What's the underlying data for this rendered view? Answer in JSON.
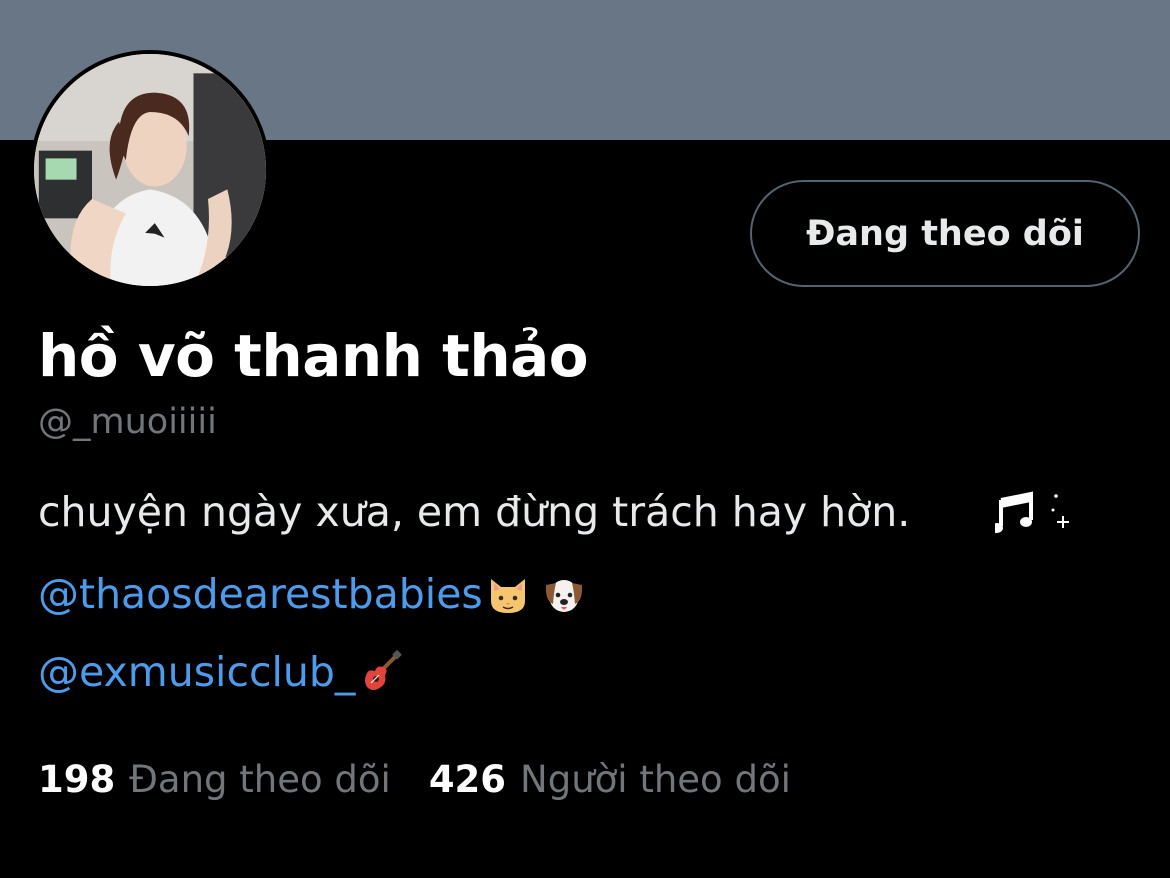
{
  "profile": {
    "display_name": "hồ võ thanh thảo",
    "handle": "@_muoiiiii",
    "bio": "chuyện ngày xưa, em đừng trách hay hờn.",
    "bio_icon": "music-note-sparkle-icon",
    "links": [
      {
        "text": "@thaosdearestbabies",
        "emojis": [
          "cat-face-icon",
          "dog-face-icon"
        ]
      },
      {
        "text": "@exmusicclub_",
        "emojis": [
          "guitar-icon"
        ]
      }
    ]
  },
  "actions": {
    "follow_label": "Đang theo dõi"
  },
  "stats": {
    "following_count": "198",
    "following_label": "Đang theo dõi",
    "followers_count": "426",
    "followers_label": "Người theo dõi"
  },
  "colors": {
    "banner": "#697686",
    "background": "#000000",
    "link": "#4d9bea",
    "secondary_text": "#71767b"
  }
}
